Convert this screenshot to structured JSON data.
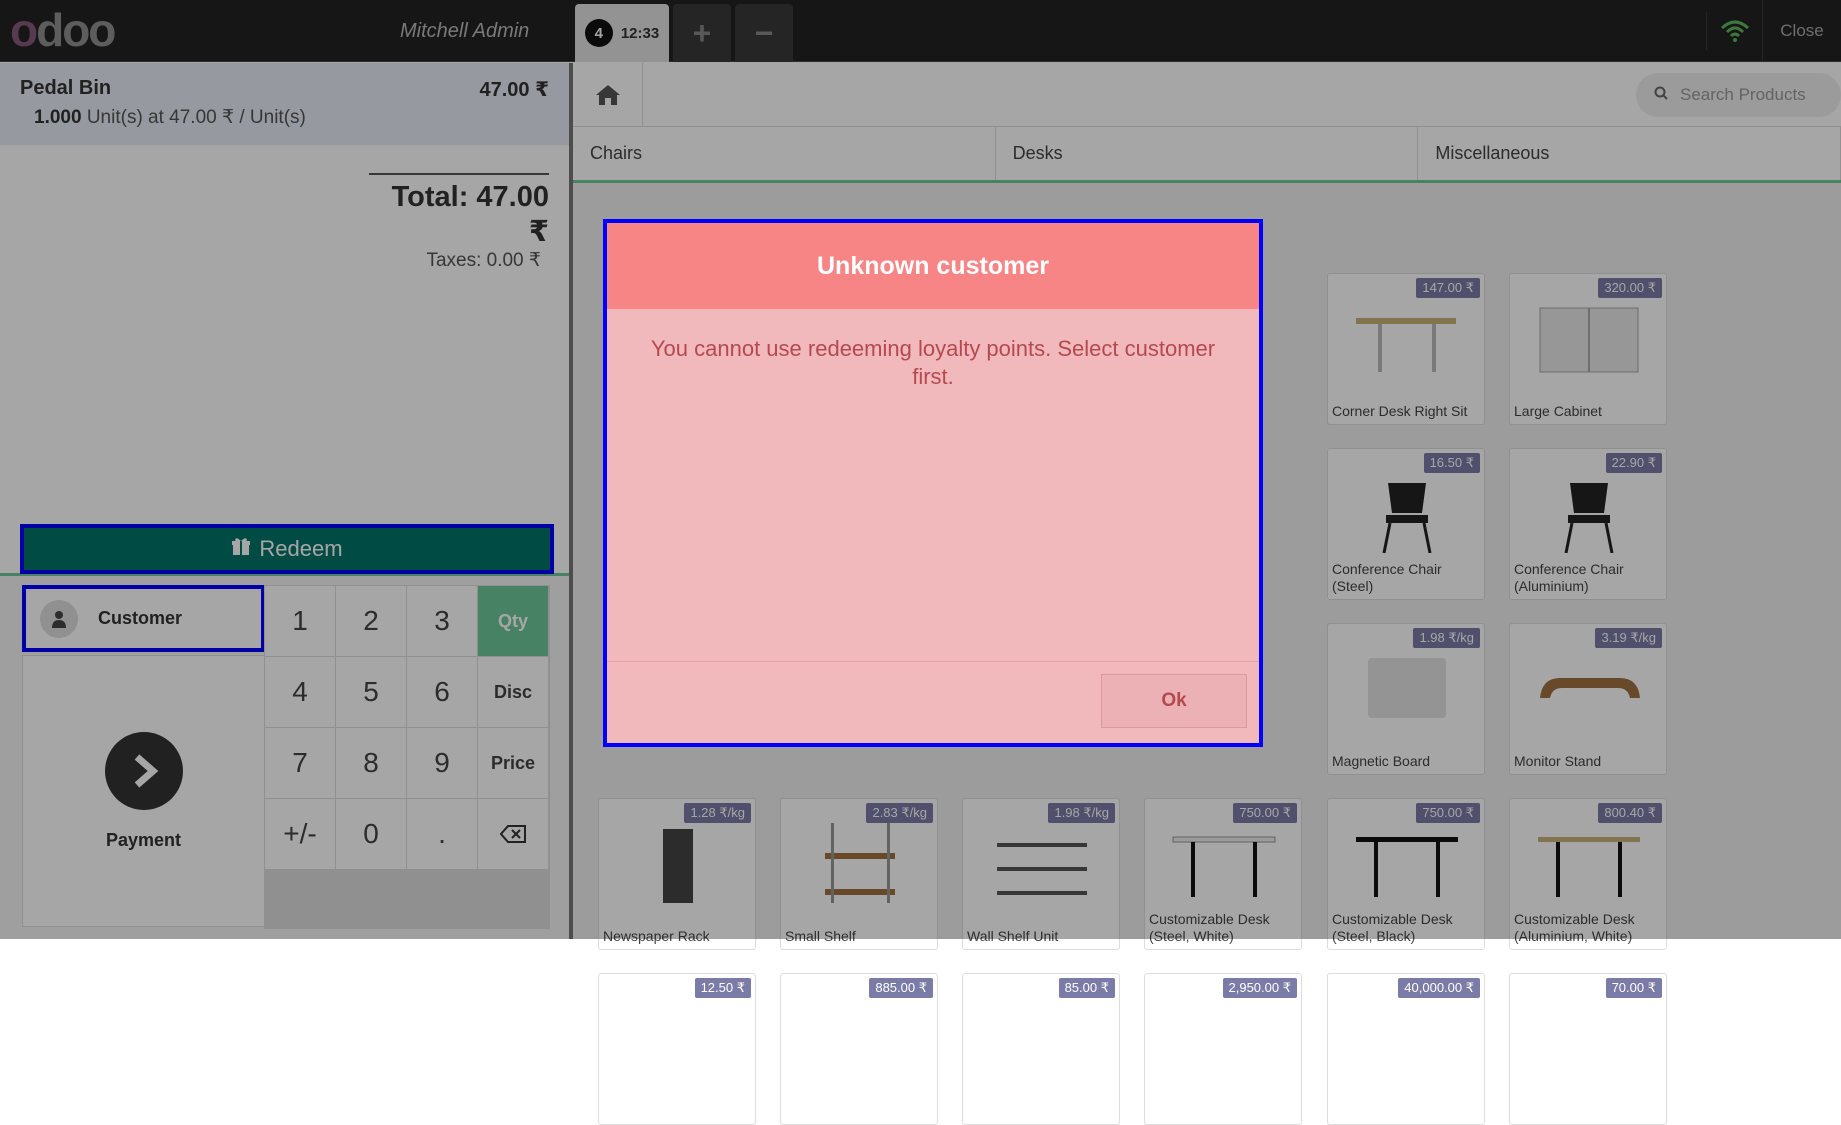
{
  "topbar": {
    "user": "Mitchell Admin",
    "order_number": "4",
    "order_time": "12:33",
    "add_label": "+",
    "remove_label": "−",
    "close_label": "Close"
  },
  "order": {
    "line_name": "Pedal Bin",
    "line_price": "47.00 ₹",
    "line_qty": "1.000",
    "line_detail": "Unit(s) at 47.00 ₹ / Unit(s)",
    "total": "Total: 47.00 ₹",
    "taxes": "Taxes: 0.00 ₹"
  },
  "controls": {
    "redeem_label": "Redeem",
    "customer_label": "Customer",
    "payment_label": "Payment",
    "keys": [
      "1",
      "2",
      "3",
      "Qty",
      "4",
      "5",
      "6",
      "Disc",
      "7",
      "8",
      "9",
      "Price",
      "+/-",
      "0",
      "."
    ]
  },
  "products_header": {
    "search_placeholder": "Search Products",
    "categories": [
      "Chairs",
      "Desks",
      "Miscellaneous"
    ]
  },
  "products": [
    {
      "name": "Corner Desk Right Sit",
      "price": "147.00 ₹"
    },
    {
      "name": "Large Cabinet",
      "price": "320.00 ₹"
    },
    {
      "name": "Conference Chair (Steel)",
      "price": "16.50 ₹"
    },
    {
      "name": "Conference Chair (Aluminium)",
      "price": "22.90 ₹"
    },
    {
      "name": "Magnetic Board",
      "price": "1.98 ₹/kg"
    },
    {
      "name": "Monitor Stand",
      "price": "3.19 ₹/kg"
    },
    {
      "name": "Newspaper Rack",
      "price": "1.28 ₹/kg"
    },
    {
      "name": "Small Shelf",
      "price": "2.83 ₹/kg"
    },
    {
      "name": "Wall Shelf Unit",
      "price": "1.98 ₹/kg"
    },
    {
      "name": "Customizable Desk (Steel, White)",
      "price": "750.00 ₹"
    },
    {
      "name": "Customizable Desk (Steel, Black)",
      "price": "750.00 ₹"
    },
    {
      "name": "Customizable Desk (Aluminium, White)",
      "price": "800.40 ₹"
    },
    {
      "name": "",
      "price": "12.50 ₹"
    },
    {
      "name": "",
      "price": "885.00 ₹"
    },
    {
      "name": "",
      "price": "85.00 ₹"
    },
    {
      "name": "",
      "price": "2,950.00 ₹"
    },
    {
      "name": "",
      "price": "40,000.00 ₹"
    },
    {
      "name": "",
      "price": "70.00 ₹"
    }
  ],
  "modal": {
    "title": "Unknown customer",
    "message": "You cannot use redeeming loyalty points. Select customer first.",
    "ok_label": "Ok"
  }
}
